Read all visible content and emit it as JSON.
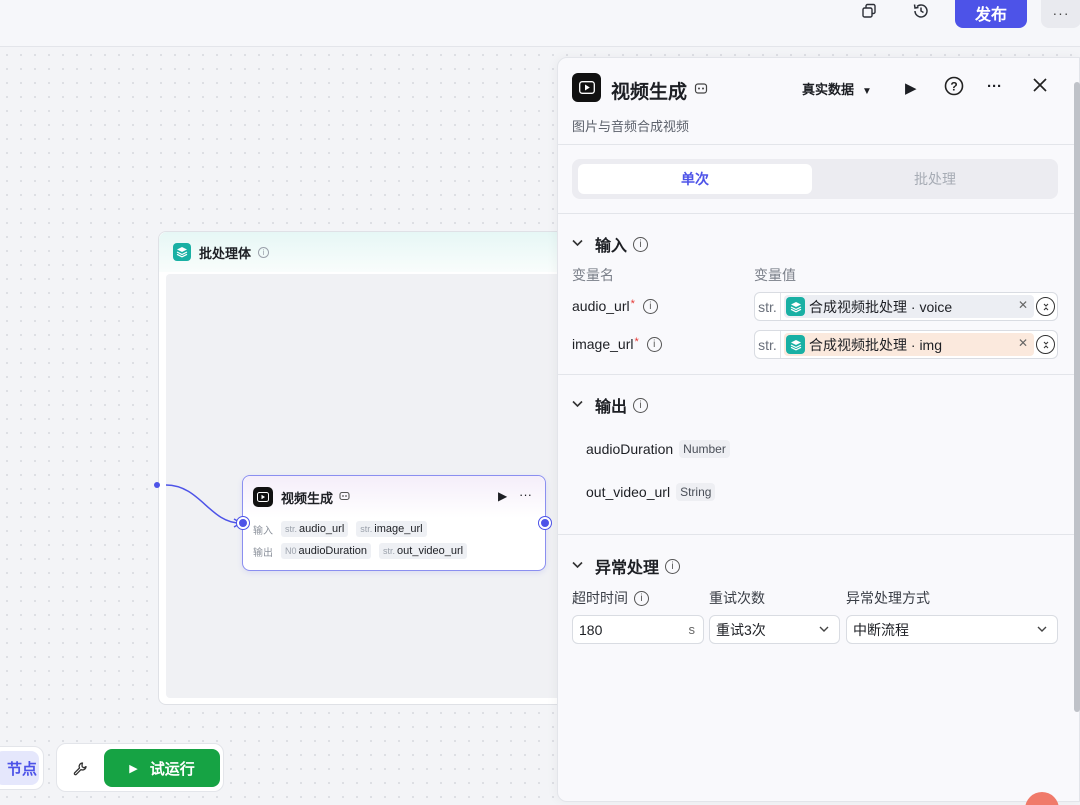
{
  "toolbar": {
    "copy_icon": "copy-icon",
    "history_icon": "history-icon",
    "publish_label": "发布",
    "more_label": "···"
  },
  "canvas": {
    "batch_container": {
      "title": "批处理体",
      "icon": "layers-icon"
    },
    "node": {
      "title": "视频生成",
      "input_label": "输入",
      "output_label": "输出",
      "inputs": [
        {
          "type": "str.",
          "name": "audio_url"
        },
        {
          "type": "str.",
          "name": "image_url"
        }
      ],
      "outputs": [
        {
          "type": "N0",
          "name": "audioDuration"
        },
        {
          "type": "str.",
          "name": "out_video_url"
        }
      ],
      "more_label": "···"
    }
  },
  "bottom": {
    "left_button_label": "节点",
    "run_label": "试运行"
  },
  "panel": {
    "title": "视频生成",
    "description": "图片与音频合成视频",
    "data_source": "真实数据",
    "more_label": "···",
    "tabs": [
      {
        "label": "单次",
        "active": true
      },
      {
        "label": "批处理",
        "active": false
      }
    ],
    "input_section": {
      "title": "输入",
      "col_name": "变量名",
      "col_value": "变量值",
      "rows": [
        {
          "name": "audio_url",
          "type": "str.",
          "ref": "合成视频批处理 · voice",
          "chip_color": "#eceef3"
        },
        {
          "name": "image_url",
          "type": "str.",
          "ref": "合成视频批处理 · img",
          "chip_color": "#fbe9dd"
        }
      ]
    },
    "output_section": {
      "title": "输出",
      "rows": [
        {
          "name": "audioDuration",
          "type": "Number"
        },
        {
          "name": "out_video_url",
          "type": "String"
        }
      ]
    },
    "exception_section": {
      "title": "异常处理",
      "timeout_label": "超时时间",
      "retry_label": "重试次数",
      "method_label": "异常处理方式",
      "timeout_value": "180",
      "timeout_unit": "s",
      "retry_value": "重试3次",
      "method_value": "中断流程"
    }
  },
  "colors": {
    "accent": "#4d53e8",
    "run_green": "#16a344",
    "teal": "#19b0a4"
  }
}
